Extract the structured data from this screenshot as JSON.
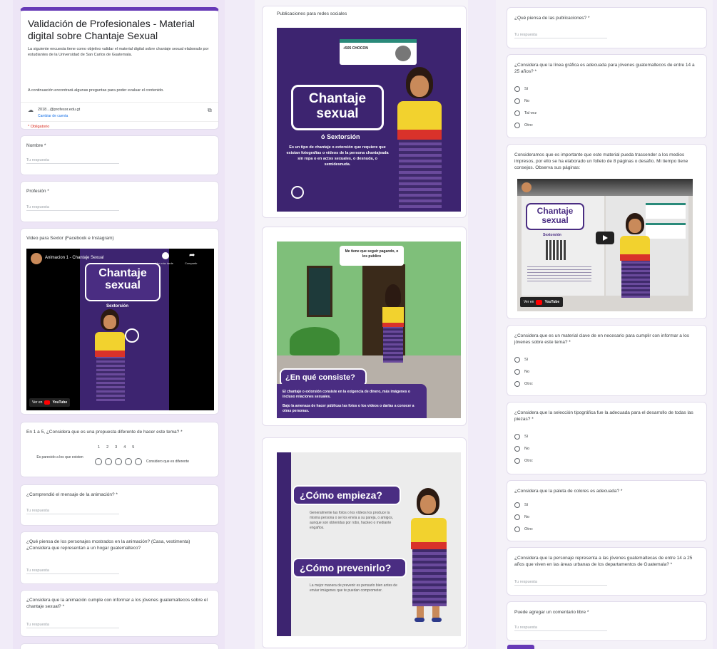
{
  "form": {
    "title": "Validación de Profesionales - Material digital sobre Chantaje Sexual",
    "description": "La siguiente encuesta tiene como objetivo validar el material digital sobre chantaje sexual elaborado por estudiantes de la Universidad de San Carlos de Guatemala.",
    "description2": "A continuación encontrará algunas preguntas para poder evaluar el contenido.",
    "account_email": "2018...@profesor.edu.gt",
    "switch_account": "Cambiar de cuenta",
    "required_note": "* Obligatorio",
    "answer_placeholder": "Tu respuesta",
    "q_name": "Nombre *",
    "q_profession": "Profesión *",
    "q_video_label": "Video para Sextor (Facebook e Instagram)",
    "q_scale": "En 1 a 5, ¿Considera que es una propuesta diferente de hacer este tema? *",
    "scale_numbers": [
      "1",
      "2",
      "3",
      "4",
      "5"
    ],
    "scale_left": "Es parecido a los que existen",
    "scale_right": "Considero que es diferente",
    "q_mensaje": "¿Comprendió el mensaje de la animación? *",
    "q_personajes": "¿Qué piensa de los personajes mostrados en la animación? (Casa, vestimenta) ¿Considera que representan a un hogar guatemalteco?",
    "q_informar": "¿Considera que la animación cumple con informar a los jóvenes guatemaltecos sobre el chantaje sexual? *"
  },
  "video": {
    "channel_title": "Animacion 1 - Chantaje Sexual",
    "watch_later": "Ver más tarde",
    "share": "Compartir",
    "brand_line1": "Chantaje",
    "brand_line2": "sexual",
    "brand_sub": "Sextorsión",
    "watch_on": "Ver en",
    "youtube": "YouTube"
  },
  "posts": {
    "header": "Publicaciones para redes sociales",
    "post1_title1": "Chantaje",
    "post1_title2": "sexual",
    "post1_sub": "ó Sextorsión",
    "post1_body": "Es un tipo de chantaje o extorsión que requiere que existan fotografías o vídeos de la persona chantajeada sin ropa o en actos sexuales, o desnuda, o semidesnuda.",
    "post1_profile": "+505 CHOCON",
    "post2_bubble": "Me tiene que seguir pagando, o los publico",
    "post2_title": "¿En qué consiste?",
    "post2_body1": "El chantaje o extorsión consiste en la exigencia de dinero, más imágenes o incluso relaciones sexuales.",
    "post2_body2": "Bajo la amenaza de hacer públicas las fotos o los vídeos o darlas a conocer a otras personas.",
    "post3_title1": "¿Cómo empieza?",
    "post3_body1": "Generalmente las fotos o los vídeos los produce la misma persona o se los envía a su pareja, o amigos, aunque son obtenidas por robo, hackeo o mediante engaños.",
    "post3_title2": "¿Cómo prevenirlo?",
    "post3_body2": "La mejor manera de prevenir es pensarlo bien antes de enviar imágenes que te puedan comprometer."
  },
  "right": {
    "q_pensamiento": "¿Qué piensa de las publicaciones? *",
    "q_linea_grafica": "¿Considera que la línea gráfica es adecuada para jóvenes guatemaltecos de entre 14 a 25 años? *",
    "opt_si": "Sí",
    "opt_no": "No",
    "opt_talvez": "Tal vez",
    "opt_otro": "Otro:",
    "q_material_text": "Consideramos que es importante que este material pueda trascender a los medios impresos, por ello se ha elaborado un folleto de 8 páginas o desafío. Mi tiempo tiene consejos. Observa sus páginas:",
    "q_cumplir": "¿Considera que es un material clave de en necesario para cumplir con informar a los jóvenes sobre este tema? *",
    "q_tipografia": "¿Considera que la selección tipográfica fue la adecuada para el desarrollo de todas las piezas? *",
    "q_colores": "¿Considera que la paleta de colores es adecuada? *",
    "q_personaje": "¿Considera que la personaje representa a las jóvenes guatemaltecas de entre 14 a 25 años que viven en las áreas urbanas de los departamentos de Guatemala? *",
    "q_comentario": "Puede agregar un comentario libre *",
    "answer_placeholder": "Tu respuesta",
    "video_watch_on": "Ver en",
    "video_youtube": "YouTube",
    "booklet_title1": "Chantaje",
    "booklet_title2": "sexual",
    "booklet_sub": "Sextorsión"
  },
  "colors": {
    "accent": "#673ab7",
    "purple_dark": "#4a2d82",
    "purple_bg": "#3d2470",
    "yellow_shirt": "#f2d22e",
    "red_belt": "#d9322a",
    "green_wall": "#7fbf7a"
  }
}
